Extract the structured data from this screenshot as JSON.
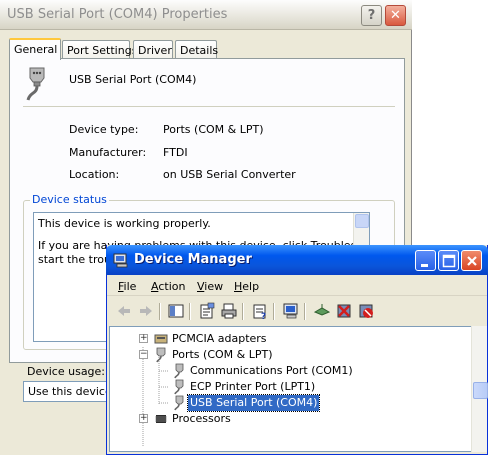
{
  "properties_window": {
    "title": "USB Serial Port (COM4) Properties",
    "help_glyph": "?",
    "close_glyph": "✕",
    "tabs": [
      {
        "label": "General"
      },
      {
        "label": "Port Settings"
      },
      {
        "label": "Driver"
      },
      {
        "label": "Details"
      }
    ],
    "device_name": "USB Serial Port (COM4)",
    "info": [
      {
        "label": "Device type:",
        "value": "Ports (COM & LPT)"
      },
      {
        "label": "Manufacturer:",
        "value": "FTDI"
      },
      {
        "label": "Location:",
        "value": "on USB Serial Converter"
      }
    ],
    "status_group_label": "Device status",
    "status_line1": "This device is working properly.",
    "status_line2": "If you are having problems with this device, click Troubleshoot to",
    "status_line3": "start the troubleshooter.",
    "usage_label": "Device usage:",
    "usage_value": "Use this device (enable)"
  },
  "device_manager": {
    "title": "Device Manager",
    "menu": [
      {
        "label": "File",
        "accel": "F",
        "rest": "ile"
      },
      {
        "label": "Action",
        "accel": "A",
        "rest": "ction"
      },
      {
        "label": "View",
        "accel": "V",
        "rest": "iew"
      },
      {
        "label": "Help",
        "accel": "H",
        "rest": "elp"
      }
    ],
    "toolbar_icons": [
      "back-arrow-icon",
      "forward-arrow-icon",
      "show-hide-console-tree-icon",
      "properties-icon",
      "print-icon",
      "help-icon",
      "scan-hardware-icon",
      "update-driver-icon",
      "uninstall-icon",
      "disable-icon"
    ],
    "tree": [
      {
        "label": "PCMCIA adapters",
        "level": 0,
        "expander": "+"
      },
      {
        "label": "Ports (COM & LPT)",
        "level": 0,
        "expander": "−"
      },
      {
        "label": "Communications Port (COM1)",
        "level": 1
      },
      {
        "label": "ECP Printer Port (LPT1)",
        "level": 1
      },
      {
        "label": "USB Serial Port (COM4)",
        "level": 1,
        "selected": true
      },
      {
        "label": "Processors",
        "level": 0,
        "expander": "+"
      }
    ]
  },
  "colors": {
    "xp_blue_title": "#0058EE",
    "selection": "#316AC5",
    "dialog_face": "#ECE9D8",
    "group_label": "#0046D5"
  }
}
